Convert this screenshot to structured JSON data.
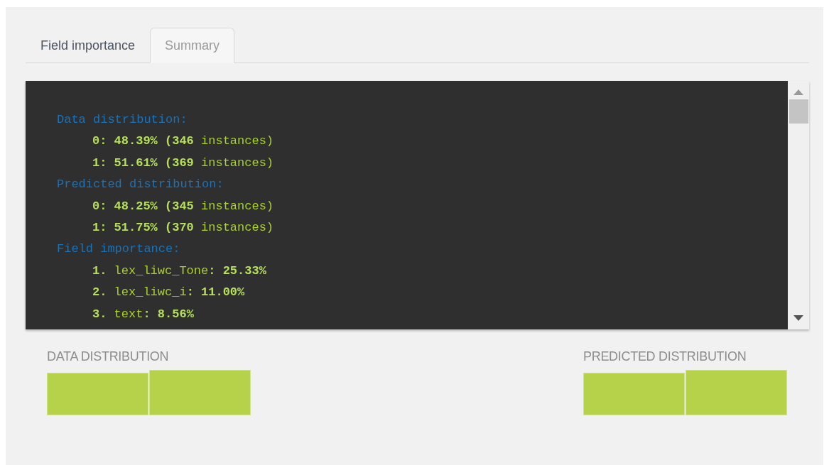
{
  "tabs": [
    {
      "label": "Field importance",
      "selected": false
    },
    {
      "label": "Summary",
      "selected": true
    }
  ],
  "summary_lines": [
    {
      "kind": "heading",
      "text": "Data distribution:"
    },
    {
      "kind": "entry",
      "text": "**0: 48.39% (346** instances)"
    },
    {
      "kind": "entry",
      "text": "**1: 51.61% (369** instances)"
    },
    {
      "kind": "heading",
      "text": "Predicted distribution:"
    },
    {
      "kind": "entry",
      "text": "**0: 48.25% (345** instances)"
    },
    {
      "kind": "entry",
      "text": "**1: 51.75% (370** instances)"
    },
    {
      "kind": "heading",
      "text": "Field importance:"
    },
    {
      "kind": "entry",
      "text": "**1.** lex_liwc_Tone**: 25.33%**"
    },
    {
      "kind": "entry",
      "text": "**2.** lex_liwc_i**: 11.00%**"
    },
    {
      "kind": "entry",
      "text": "**3.** text**: 8.56%**"
    }
  ],
  "distributions": [
    {
      "title": "DATA DISTRIBUTION"
    },
    {
      "title": "PREDICTED DISTRIBUTION"
    }
  ]
}
